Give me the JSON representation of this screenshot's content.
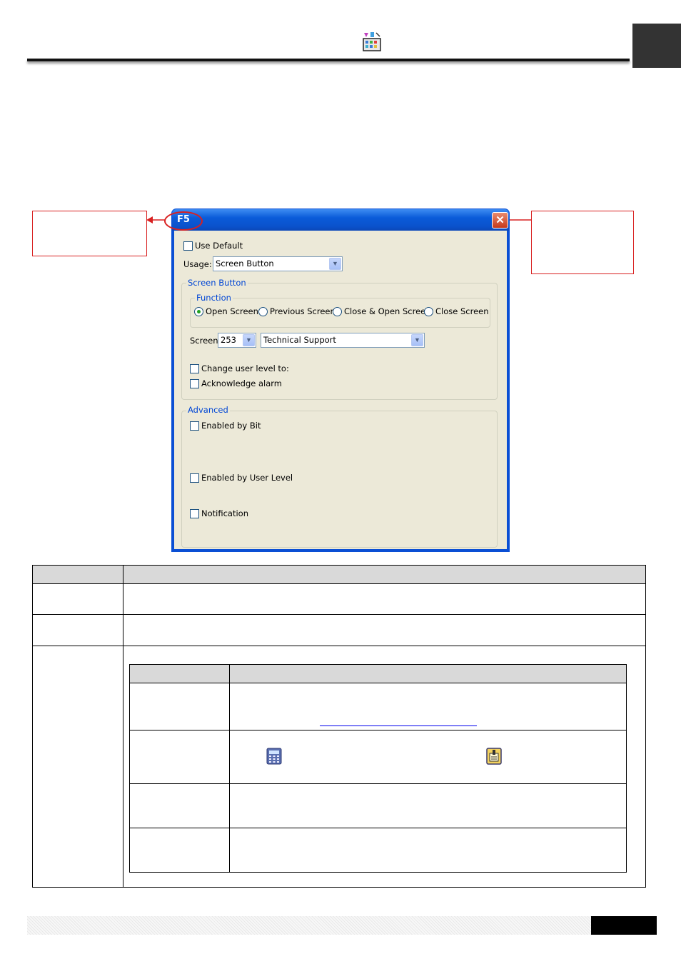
{
  "dialog": {
    "title": "F5",
    "close_glyph": "✕",
    "use_default_label": "Use Default",
    "usage_label": "Usage:",
    "usage_value": "Screen Button",
    "screen_button_group": "Screen Button",
    "function_group": "Function",
    "function_options": [
      "Open Screen",
      "Previous Screen",
      "Close & Open Screen",
      "Close Screen"
    ],
    "function_selected": "Open Screen",
    "screen_label": "Screen:",
    "screen_number": "253",
    "screen_name": "Technical Support",
    "change_user_level_label": "Change user level to:",
    "acknowledge_alarm_label": "Acknowledge alarm",
    "advanced_group": "Advanced",
    "enabled_by_bit_label": "Enabled by Bit",
    "enabled_by_user_level_label": "Enabled by User Level",
    "notification_label": "Notification"
  },
  "colors": {
    "titlebar": "#0a5bd9",
    "dialog_bg": "#ece9d8",
    "callout_red": "#d82020",
    "group_title_blue": "#0046d5",
    "table_header_grey": "#d9d9d9"
  },
  "icons": {
    "header": "toolbox-icon",
    "calculator": "calculator-icon",
    "address": "address-tag-icon"
  }
}
